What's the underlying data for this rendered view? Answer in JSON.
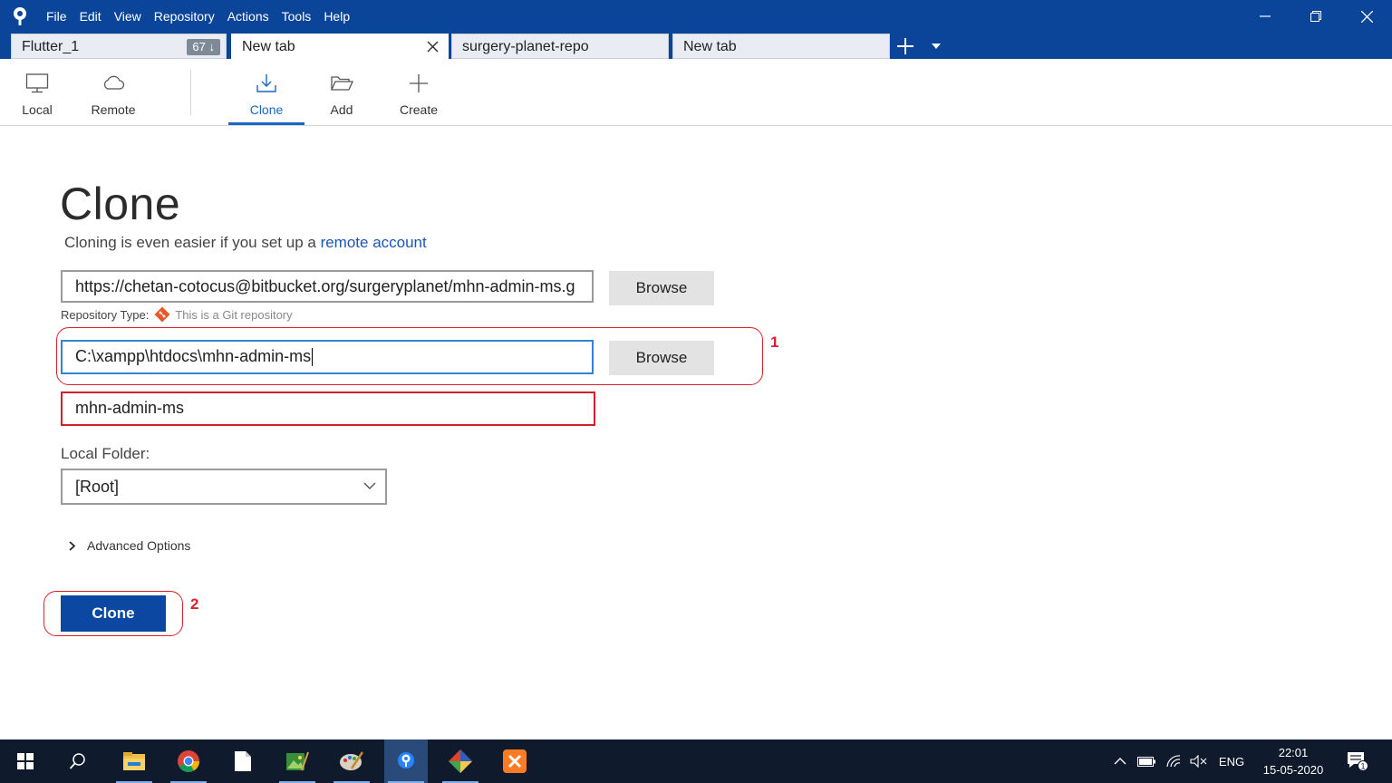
{
  "app": {
    "menu": [
      "File",
      "Edit",
      "View",
      "Repository",
      "Actions",
      "Tools",
      "Help"
    ]
  },
  "tabs": [
    {
      "label": "Flutter_1",
      "badge": "67 ↓"
    },
    {
      "label": "New tab"
    },
    {
      "label": "surgery-planet-repo"
    },
    {
      "label": "New tab"
    }
  ],
  "toolbar": {
    "local": "Local",
    "remote": "Remote",
    "clone": "Clone",
    "add": "Add",
    "create": "Create"
  },
  "clone_page": {
    "title": "Clone",
    "hint_text": "Cloning is even easier if you set up a",
    "hint_link": "remote account",
    "source_url": "https://chetan-cotocus@bitbucket.org/surgeryplanet/mhn-admin-ms.g",
    "browse_label": "Browse",
    "repo_type_label": "Repository Type:",
    "repo_type_value": "This is a Git repository",
    "destination_path": "C:\\xampp\\htdocs\\mhn-admin-ms",
    "name": "mhn-admin-ms",
    "local_folder_label": "Local Folder:",
    "local_folder_value": "[Root]",
    "advanced_label": "Advanced Options",
    "clone_button": "Clone"
  },
  "annotations": {
    "one": "1",
    "two": "2",
    "color": "#d9202e"
  },
  "taskbar": {
    "lang": "ENG",
    "time": "22:01",
    "date": "15-05-2020",
    "notifications": "1"
  },
  "colors": {
    "titlebar": "#0b4599",
    "accent": "#1967c4",
    "clone_button": "#0c47a1"
  }
}
